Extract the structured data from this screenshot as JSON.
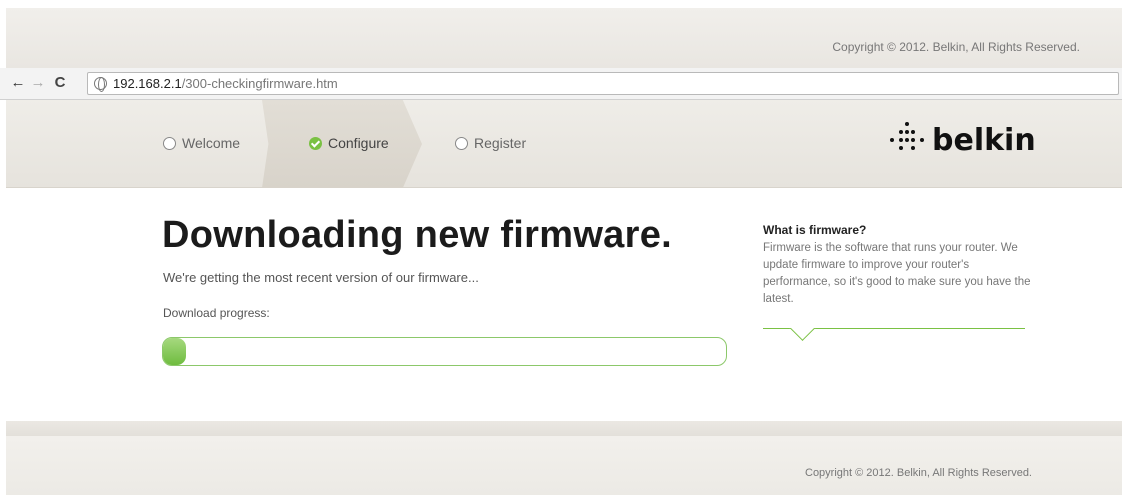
{
  "header": {
    "copyright": "Copyright © 2012. Belkin, All Rights Reserved."
  },
  "browser": {
    "url_host": "192.168.2.1",
    "url_path": "/300-checkingfirmware.htm",
    "icons": {
      "back": "arrow-left-icon",
      "forward": "arrow-right-icon",
      "reload": "reload-icon",
      "site": "globe-icon"
    }
  },
  "steps": [
    {
      "label": "Welcome",
      "state": "pending"
    },
    {
      "label": "Configure",
      "state": "active"
    },
    {
      "label": "Register",
      "state": "pending"
    }
  ],
  "logo": {
    "text": "belkin"
  },
  "main": {
    "title": "Downloading new firmware.",
    "subtitle": "We're getting the most recent version of our firmware...",
    "progress_label": "Download progress:",
    "progress_fraction": 0.04
  },
  "sidebar": {
    "title": "What is firmware?",
    "body": "Firmware is the software that runs your router. We update firmware to improve your router's performance, so it's good to make sure you have the latest."
  },
  "footer": {
    "copyright": "Copyright © 2012. Belkin, All Rights Reserved."
  },
  "colors": {
    "accent_green": "#7ac143"
  }
}
